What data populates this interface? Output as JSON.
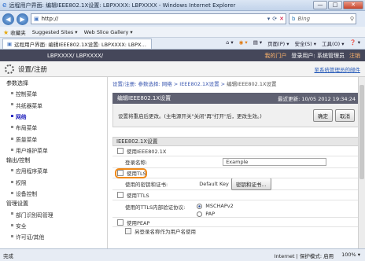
{
  "window": {
    "title": "远程用户界面: 编辑IEEE802.1X设置: LBPXXXX: LBPXXXX - Windows Internet Explorer"
  },
  "address": {
    "url": "http://",
    "search_placeholder": "Bing"
  },
  "favorites": {
    "label": "收藏夹",
    "suggested": "Suggested Sites ▾",
    "web_slice": "Web Slice Gallery ▾"
  },
  "tabs": {
    "active": "远程用户界面: 编辑IEEE802.1X设置: LBPXXXX: LBPXXXX",
    "toolbar": [
      "页面(P) ▾",
      "安全(S) ▾",
      "工具(O) ▾",
      "❓ ▾"
    ]
  },
  "header": {
    "model": "LBPXXXX/ LBPXXXX/",
    "my_portal": "我的门户",
    "login_user": "登录用户: 系统管理员",
    "logout": "注销"
  },
  "page": {
    "title": "设置/注册",
    "mail": "至系统管理员的邮件"
  },
  "sidebar": {
    "sections": [
      {
        "label": "参数选择",
        "items": [
          "控制菜单",
          "共纸器菜单",
          "网络",
          "布局菜单",
          "质量菜单",
          "用户维护菜单"
        ]
      },
      {
        "label": "输出/控制",
        "items": [
          "应用程序菜单",
          "权限",
          "设备控制"
        ]
      },
      {
        "label": "管理设置",
        "items": [
          "部门识别码管理",
          "安全",
          "许可证/其他"
        ]
      }
    ],
    "active": "网络"
  },
  "main": {
    "breadcrumb": "设置/注册: 参数选择: 网络 > IEEE802.1X设置 >",
    "breadcrumb_current": "编辑IEEE802.1X设置",
    "panel_title": "编辑IEEE802.1X设置",
    "last_update": "最近更新: 10/05 2012 19:34:24",
    "notice": "设置将重启后更改。(主电源开关\"关闭\"再\"打开\"后，更改生效。)",
    "ok_label": "确定",
    "cancel_label": "取消",
    "section_title": "IEEE802.1X设置",
    "use_8021x": "使用IEEE802.1X",
    "login_name_label": "登录名称:",
    "login_name_value": "Example",
    "use_tls": "使用TLS",
    "key_label": "使用的密钥和证书:",
    "key_value": "Default Key",
    "key_button": "密钥和证书...",
    "use_ttls": "使用TTLS",
    "ttls_protocol_label": "使用的TTLS内部验证协议:",
    "ttls_options": [
      "MSCHAPv2",
      "PAP"
    ],
    "ttls_selected": "MSCHAPv2",
    "use_peap": "使用PEAP",
    "use_login_as_user": "另登录名称作为用户名使用"
  },
  "status": {
    "left": "完成",
    "zone": "Internet | 保护模式: 启用",
    "zoom": "100% ▾"
  }
}
